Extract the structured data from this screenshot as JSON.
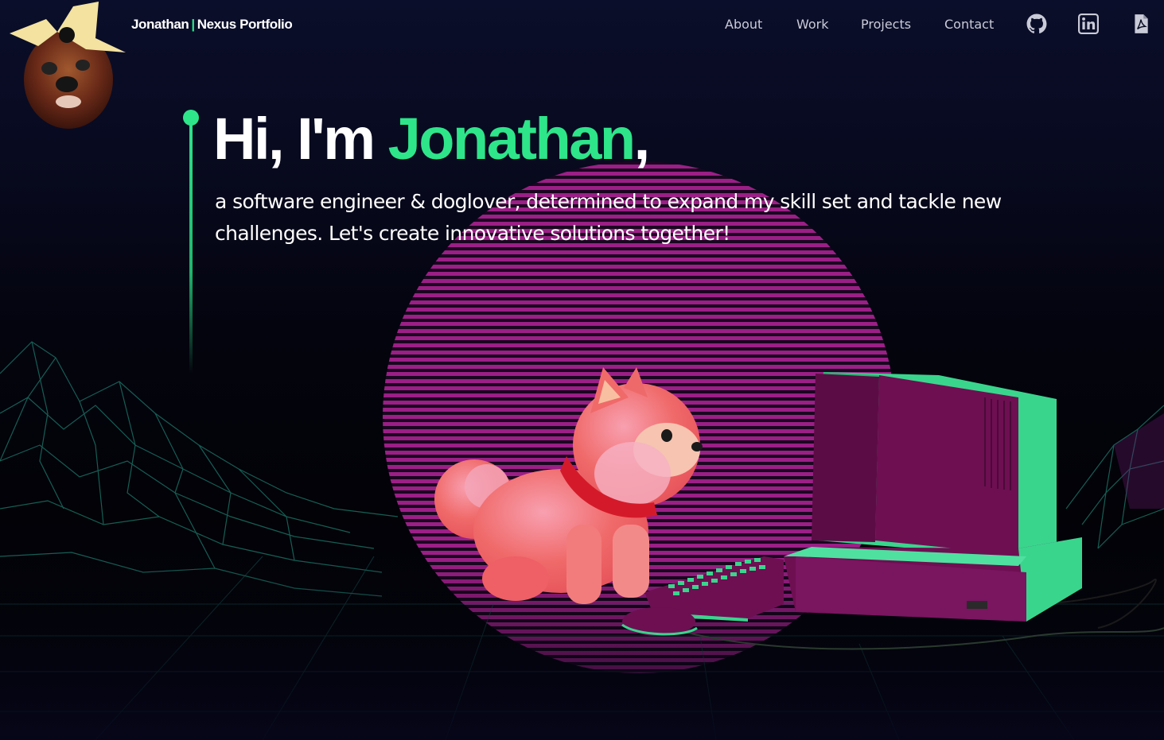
{
  "navbar": {
    "brand_first": "Jonathan",
    "brand_separator": "|",
    "brand_second": "Nexus Portfolio",
    "links": [
      {
        "label": "About"
      },
      {
        "label": "Work"
      },
      {
        "label": "Projects"
      },
      {
        "label": "Contact"
      }
    ],
    "icons": [
      "github-icon",
      "linkedin-icon",
      "pdf-resume-icon"
    ]
  },
  "hero": {
    "greeting": "Hi, I'm ",
    "name": "Jonathan",
    "comma": ",",
    "subtitle": "a software engineer & doglover, determined to expand my skill set and tackle new challenges. Let's create innovative solutions together!"
  },
  "colors": {
    "accent": "#2ee58a",
    "sun": "#8a1a8e",
    "background": "#04040e",
    "grid": "#1f7a6a",
    "computer": "#6e0f52",
    "computer_trim": "#3ad58d",
    "dog": "#f06a6a"
  }
}
